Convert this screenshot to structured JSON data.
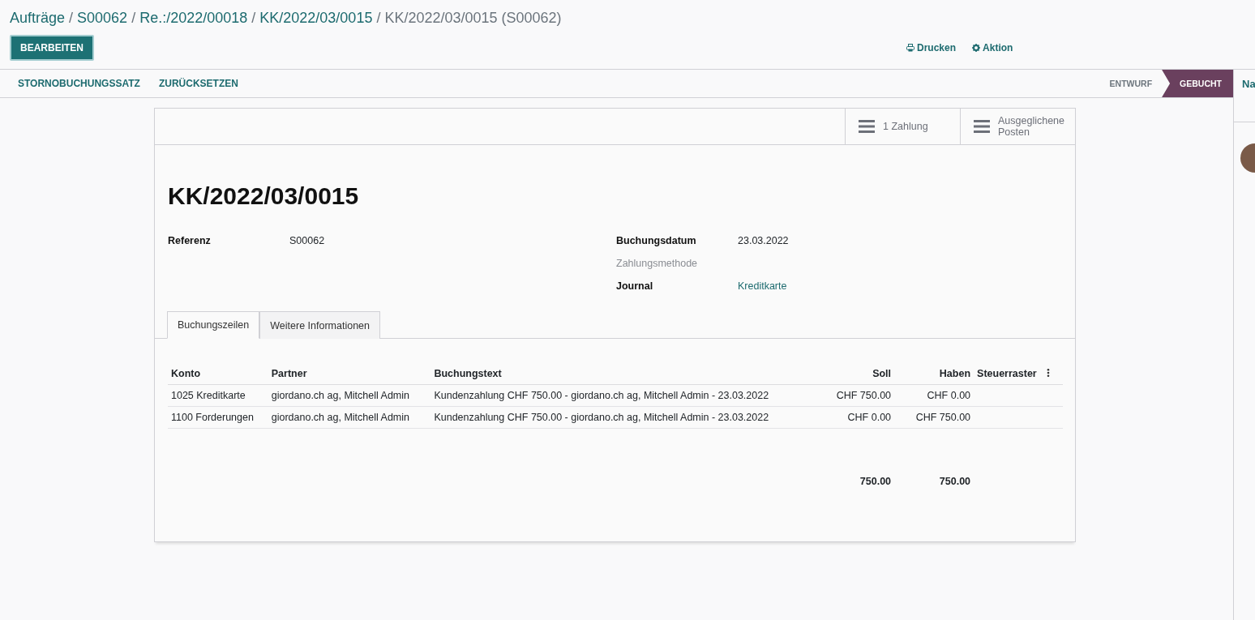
{
  "breadcrumbs": [
    {
      "label": "Aufträge",
      "link": true
    },
    {
      "separator": "/"
    },
    {
      "label": "S00062",
      "link": true
    },
    {
      "separator": "/"
    },
    {
      "label": "Re.:/2022/00018",
      "link": true
    },
    {
      "separator": "/"
    },
    {
      "label": "KK/2022/03/0015",
      "link": true
    },
    {
      "separator": "/"
    },
    {
      "label": "KK/2022/03/0015 (S00062)",
      "link": false
    }
  ],
  "edit_button": "BEARBEITEN",
  "actions": [
    {
      "kind": "print",
      "label": "Drucken"
    },
    {
      "kind": "gear",
      "label": "Aktion"
    }
  ],
  "header_buttons": [
    "STORNOBUCHUNGSSATZ",
    "ZURÜCKSETZEN"
  ],
  "status_steps": [
    {
      "label": "ENTWURF",
      "selected": false
    },
    {
      "label": "GEBUCHT",
      "selected": true
    }
  ],
  "chatter": {
    "title": "Na"
  },
  "smart_buttons": [
    {
      "label": "1 Zahlung"
    },
    {
      "label": "Ausgeglichene Posten"
    }
  ],
  "title": "KK/2022/03/0015",
  "fields_left": [
    {
      "label": "Referenz",
      "value": "S00062",
      "muted": false,
      "link": false
    }
  ],
  "fields_right": [
    {
      "label": "Buchungsdatum",
      "value": "23.03.2022",
      "muted": false,
      "link": false
    },
    {
      "label": "Zahlungsmethode",
      "muted": true,
      "link": false
    },
    {
      "label": "Journal",
      "value": "Kreditkarte",
      "muted": false,
      "link": true
    }
  ],
  "tabs": [
    {
      "label": "Buchungszeilen",
      "selected": true
    },
    {
      "label": "Weitere Informationen",
      "selected": false
    }
  ],
  "table": {
    "columns": [
      {
        "label": "Konto",
        "numeric": false
      },
      {
        "label": "Partner",
        "numeric": false
      },
      {
        "label": "Buchungstext",
        "numeric": false
      },
      {
        "label": "Soll",
        "numeric": true
      },
      {
        "label": "Haben",
        "numeric": true
      },
      {
        "label": "Steuerraster",
        "numeric": false
      }
    ],
    "rows": [
      [
        "1025 Kreditkarte",
        "giordano.ch ag, Mitchell Admin",
        "Kundenzahlung CHF 750.00 - giordano.ch ag, Mitchell Admin - 23.03.2022",
        "CHF 750.00",
        "CHF 0.00",
        ""
      ],
      [
        "1100 Forderungen",
        "giordano.ch ag, Mitchell Admin",
        "Kundenzahlung CHF 750.00 - giordano.ch ag, Mitchell Admin - 23.03.2022",
        "CHF 0.00",
        "CHF 750.00",
        ""
      ]
    ],
    "totals": {
      "soll": "750.00",
      "haben": "750.00"
    }
  }
}
